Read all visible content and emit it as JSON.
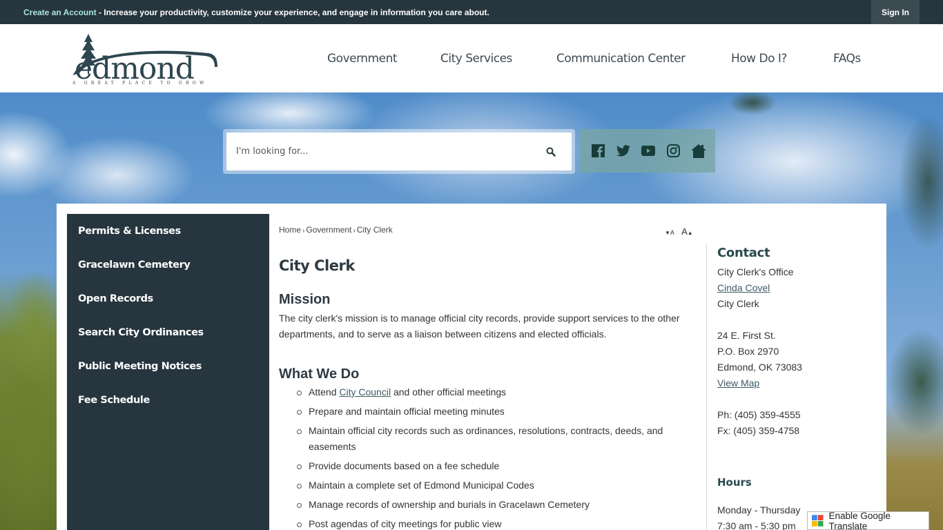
{
  "topbar": {
    "create_account_label": "Create an Account",
    "message": " - Increase your productivity, customize your experience, and engage in information you care about.",
    "sign_in_label": "Sign In"
  },
  "brand": {
    "name": "edmond",
    "tagline": "A GREAT PLACE TO GROW",
    "color": "#2f4650"
  },
  "nav": {
    "items": [
      {
        "label": "Government"
      },
      {
        "label": "City Services"
      },
      {
        "label": "Communication Center"
      },
      {
        "label": "How Do I?"
      },
      {
        "label": "FAQs"
      }
    ]
  },
  "search": {
    "placeholder": "I'm looking for...",
    "value": ""
  },
  "social": {
    "icons": [
      "facebook-icon",
      "twitter-icon",
      "youtube-icon",
      "instagram-icon",
      "home-icon"
    ]
  },
  "sidebar": {
    "items": [
      {
        "label": "Permits & Licenses"
      },
      {
        "label": "Gracelawn Cemetery"
      },
      {
        "label": "Open Records"
      },
      {
        "label": "Search City Ordinances"
      },
      {
        "label": "Public Meeting Notices"
      },
      {
        "label": "Fee Schedule"
      }
    ]
  },
  "breadcrumb": {
    "items": [
      "Home",
      "Government",
      "City Clerk"
    ],
    "separator": "›"
  },
  "font_size": {
    "decrease_label": "A",
    "increase_label": "A"
  },
  "main": {
    "title": "City Clerk",
    "mission_heading": "Mission",
    "mission_text": "The city clerk's mission is to manage official city records, provide support services to the other departments, and to serve as a liaison between citizens and elected officials.",
    "what_we_do_heading": "What We Do",
    "what_we_do": {
      "item0_prefix": "Attend ",
      "item0_link": "City Council",
      "item0_suffix": " and other official meetings",
      "items": [
        "Prepare and maintain official meeting minutes",
        "Maintain official city records such as ordinances, resolutions, contracts, deeds, and easements",
        "Provide documents based on a fee schedule",
        "Maintain a complete set of Edmond Municipal Codes",
        "Manage records of ownership and burials in Gracelawn Cemetery",
        "Post agendas of city meetings for public view"
      ]
    }
  },
  "contact": {
    "heading": "Contact",
    "office": "City Clerk's Office",
    "person_link": "Cinda Covel",
    "person_title": "City Clerk",
    "address1": "24 E. First St.",
    "address2": "P.O. Box 2970",
    "address3": "Edmond, OK 73083",
    "map_link": "View Map",
    "phone": "Ph: (405) 359-4555",
    "fax": "Fx: (405) 359-4758"
  },
  "hours": {
    "heading": "Hours",
    "days": "Monday - Thursday",
    "time": "7:30 am - 5:30 pm"
  },
  "translate": {
    "label": "Enable Google Translate"
  }
}
